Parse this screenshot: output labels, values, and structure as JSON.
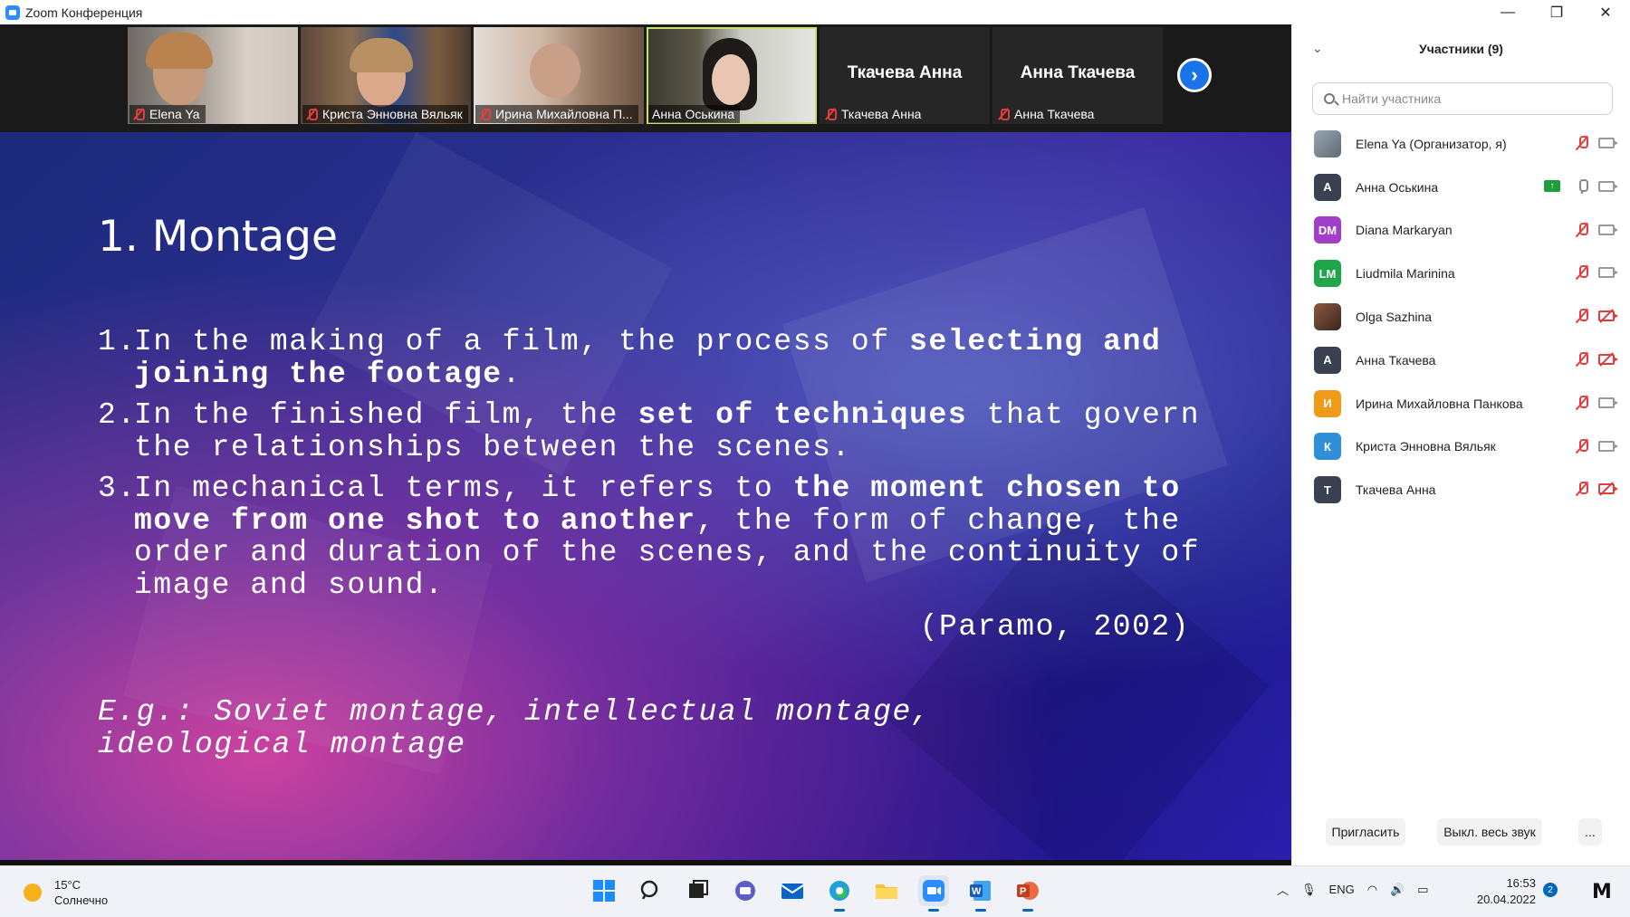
{
  "window": {
    "title": "Zoom Конференция",
    "controls": {
      "minimize": "—",
      "restore": "❐",
      "close": "✕"
    }
  },
  "video_strip": {
    "tiles": [
      {
        "name": "Elena Ya",
        "type": "video"
      },
      {
        "name": "Криста Энновна Вяльяк",
        "type": "video"
      },
      {
        "name": "Ирина Михайловна П...",
        "type": "video"
      },
      {
        "name": "Анна Оськина",
        "type": "video",
        "active": true
      },
      {
        "name": "Ткачева Анна",
        "big_name": "Ткачева Анна",
        "type": "name"
      },
      {
        "name": "Анна Ткачева",
        "big_name": "Анна Ткачева",
        "type": "name"
      }
    ],
    "next_glyph": "›"
  },
  "slide": {
    "title": "1. Montage",
    "items": [
      {
        "num": "1.",
        "parts": [
          "In the making of a film, the process of ",
          "selecting and joining the footage",
          "."
        ]
      },
      {
        "num": "2.",
        "parts": [
          "In the finished film, the ",
          "set of techniques",
          " that govern the relationships between the scenes."
        ]
      },
      {
        "num": "3.",
        "parts": [
          "In mechanical terms, it refers to ",
          "the moment chosen to move from one shot to another",
          ", the form of change, the order and duration of the scenes, and the continuity of image and sound."
        ]
      }
    ],
    "citation": "(Paramo, 2002)",
    "example": "E.g.: Soviet montage, intellectual montage, ideological montage"
  },
  "participants": {
    "title": "Участники (9)",
    "search_placeholder": "Найти участника",
    "list": [
      {
        "name": "Elena Ya (Организатор, я)",
        "initials": "",
        "color": "#7a8a9a",
        "mic": "off",
        "cam": "on",
        "photo": true
      },
      {
        "name": "Анна Оськина",
        "initials": "А",
        "color": "#3a4150",
        "mic": "on",
        "cam": "on",
        "sharing": true
      },
      {
        "name": "Diana Markaryan",
        "initials": "DM",
        "color": "#a23ec9",
        "mic": "off",
        "cam": "on"
      },
      {
        "name": "Liudmila Marinina",
        "initials": "LM",
        "color": "#1fa64a",
        "mic": "off",
        "cam": "on"
      },
      {
        "name": "Olga Sazhina",
        "initials": "",
        "color": "#5a3b30",
        "mic": "off",
        "cam": "off",
        "photo": true
      },
      {
        "name": "Анна Ткачева",
        "initials": "А",
        "color": "#3a4150",
        "mic": "off",
        "cam": "off"
      },
      {
        "name": "Ирина Михайловна Панкова",
        "initials": "И",
        "color": "#f09a1a",
        "mic": "off",
        "cam": "on"
      },
      {
        "name": "Криста Энновна Вяльяк",
        "initials": "К",
        "color": "#2f8fd8",
        "mic": "off",
        "cam": "on"
      },
      {
        "name": "Ткачева Анна",
        "initials": "Т",
        "color": "#3a4150",
        "mic": "off",
        "cam": "off"
      }
    ],
    "footer": {
      "invite": "Пригласить",
      "mute_all": "Выкл. весь звук",
      "more": "..."
    }
  },
  "taskbar": {
    "weather_temp": "15°C",
    "weather_desc": "Солнечно",
    "language": "ENG",
    "time": "16:53",
    "date": "20.04.2022",
    "notifications": "2",
    "corner_logo": "M"
  }
}
